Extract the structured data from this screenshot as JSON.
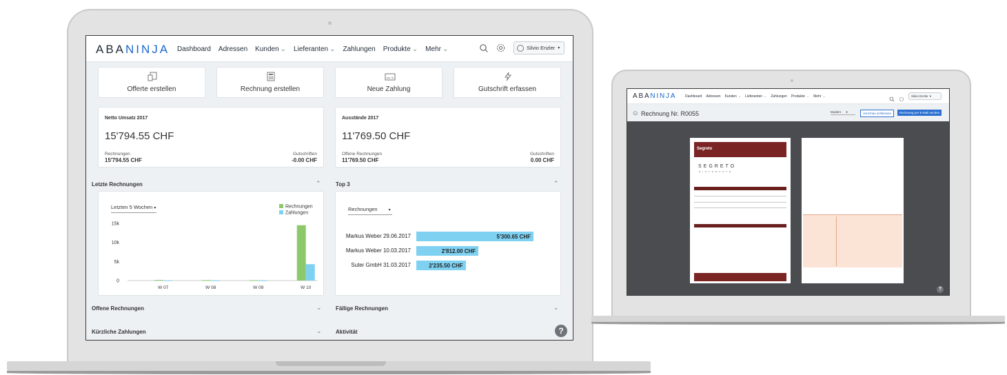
{
  "brand": {
    "logo_a": "ABA",
    "logo_b": "NINJA",
    "accent": "#1a66c9"
  },
  "nav": [
    {
      "label": "Dashboard",
      "dropdown": false
    },
    {
      "label": "Adressen",
      "dropdown": false
    },
    {
      "label": "Kunden",
      "dropdown": true
    },
    {
      "label": "Lieferanten",
      "dropdown": true
    },
    {
      "label": "Zahlungen",
      "dropdown": false
    },
    {
      "label": "Produkte",
      "dropdown": true
    },
    {
      "label": "Mehr",
      "dropdown": true
    }
  ],
  "user": {
    "name": "Silvio Enzler"
  },
  "quick_actions": [
    {
      "label": "Offerte erstellen",
      "icon": "document-icon"
    },
    {
      "label": "Rechnung erstellen",
      "icon": "calculator-icon"
    },
    {
      "label": "Neue Zahlung",
      "icon": "payment-slip-icon"
    },
    {
      "label": "Gutschrift erfassen",
      "icon": "lightning-icon"
    }
  ],
  "stats": {
    "netto": {
      "title": "Netto Umsatz 2017",
      "amount": "15'794.55 CHF",
      "left_label": "Rechnungen",
      "left_value": "15'794.55 CHF",
      "right_label": "Gutschriften",
      "right_value": "-0.00 CHF"
    },
    "ausstaende": {
      "title": "Ausstände 2017",
      "amount": "11'769.50 CHF",
      "left_label": "Offene Rechnungen",
      "left_value": "11'769.50 CHF",
      "right_label": "Gutschriften",
      "right_value": "0.00 CHF"
    }
  },
  "sections": {
    "letzte": "Letzte Rechnungen",
    "top3": "Top 3",
    "offene": "Offene Rechnungen",
    "faellige": "Fällige Rechnungen",
    "kuerzliche": "Kürzliche Zahlungen",
    "aktivitaet": "Aktivität"
  },
  "chart_data": [
    {
      "type": "bar",
      "period_select": "Letzten 5 Wochen",
      "categories": [
        "W 07",
        "W 08",
        "W 09",
        "W 10"
      ],
      "series": [
        {
          "name": "Rechnungen",
          "color": "#8cc96a",
          "values": [
            150,
            120,
            100,
            14500
          ]
        },
        {
          "name": "Zahlungen",
          "color": "#7fd1f2",
          "values": [
            60,
            50,
            40,
            4300
          ]
        }
      ],
      "yticks": [
        "15k",
        "10k",
        "5k",
        "0"
      ],
      "ylim": [
        0,
        15000
      ],
      "legend": "top-right"
    },
    {
      "type": "bar",
      "orientation": "horizontal",
      "select": "Rechnungen",
      "categories": [
        "Markus Weber 29.06.2017",
        "Markus Weber 10.03.2017",
        "Suter GmbH 31.03.2017"
      ],
      "values": [
        5300.65,
        2812.0,
        2235.5
      ],
      "value_labels": [
        "5'300.65 CHF",
        "2'812.00 CHF",
        "2'235.50 CHF"
      ],
      "color": "#7fd1f2"
    }
  ],
  "small": {
    "doc_title": "Rechnung Nr. R0055",
    "template_select": "Modern",
    "btn_preview": "Vorschau schliessen",
    "btn_send": "Rechnung per E-Mail senden",
    "company": "Segreto",
    "company_logo": "SEGRETO",
    "company_sub": "RISTORANTE",
    "help": "?"
  },
  "help": "?"
}
